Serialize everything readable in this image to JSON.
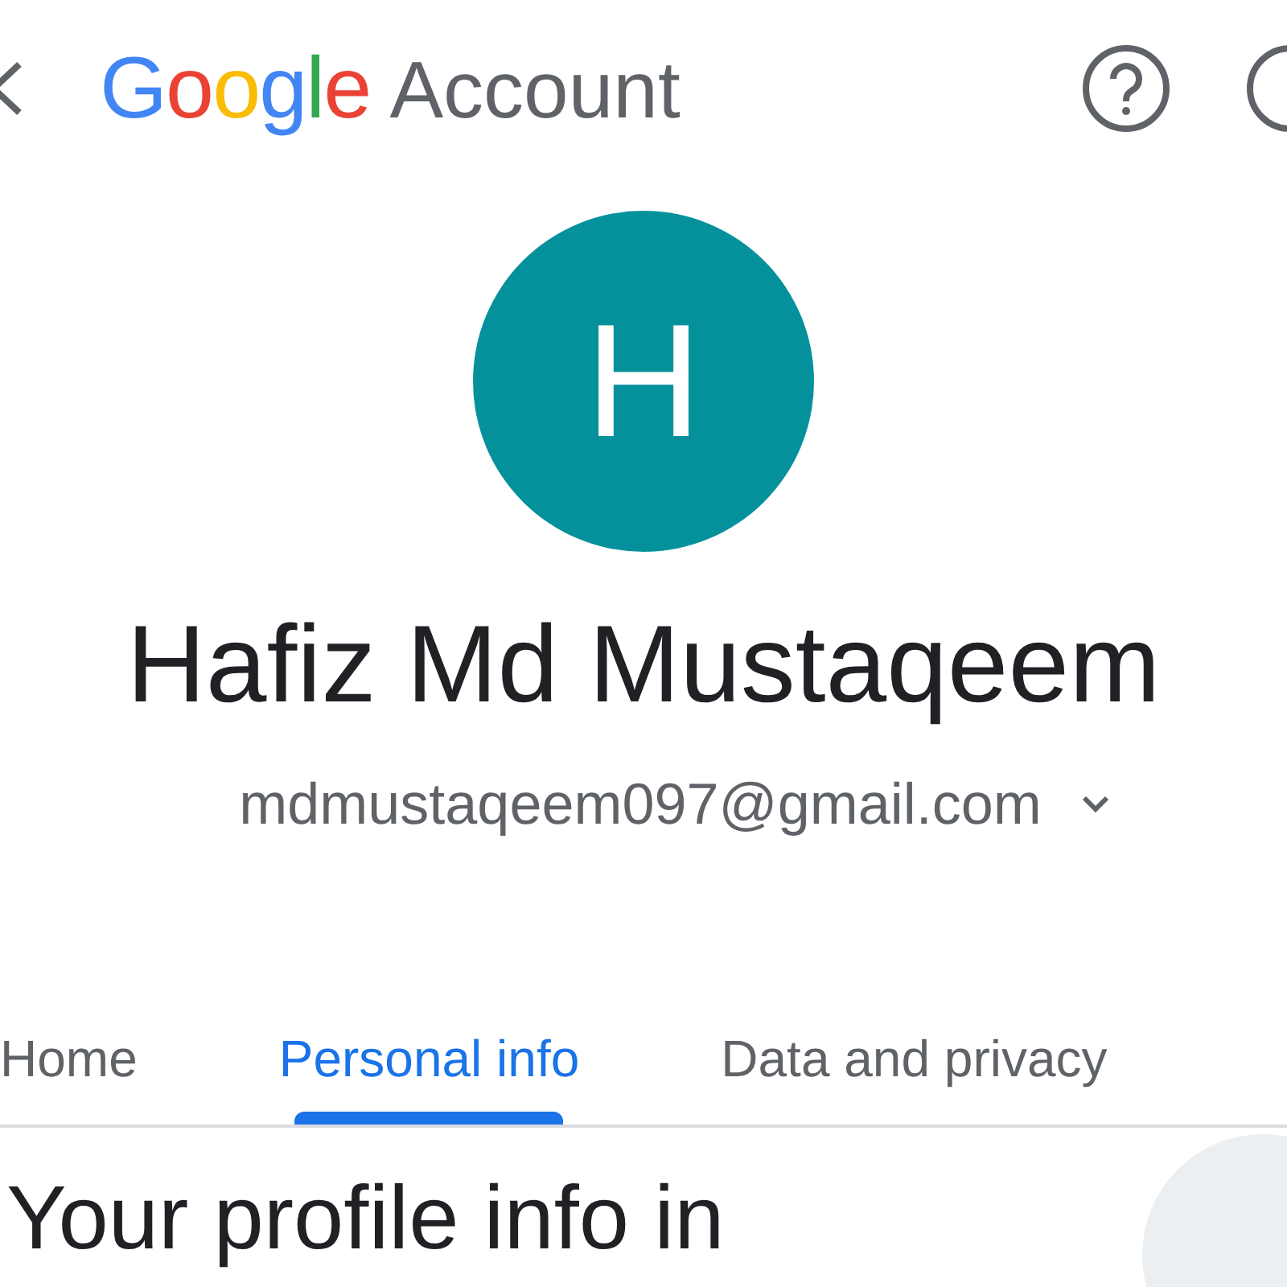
{
  "header": {
    "logo": "Google",
    "title": "Account"
  },
  "profile": {
    "initial": "H",
    "name": "Hafiz Md Mustaqeem",
    "email": "mdmustaqeem097@gmail.com"
  },
  "tabs": [
    {
      "label": "Home",
      "selected": false
    },
    {
      "label": "Personal info",
      "selected": true
    },
    {
      "label": "Data and privacy",
      "selected": false
    }
  ],
  "section": {
    "heading": "Your profile info in"
  }
}
